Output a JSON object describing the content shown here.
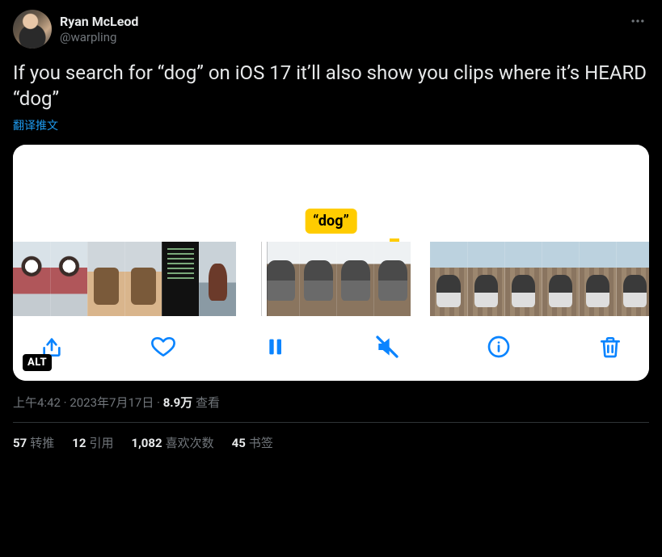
{
  "author": {
    "display_name": "Ryan McLeod",
    "handle": "@warpling"
  },
  "tweet_text": "If you search for “dog” on iOS 17 it’ll also show you clips where it’s HEARD “dog”",
  "translate_label": "翻译推文",
  "media": {
    "caption_label": "“dog”",
    "alt_badge": "ALT",
    "toolbar": {
      "share": "share-icon",
      "like": "heart-icon",
      "pause": "pause-icon",
      "mute": "speaker-off-icon",
      "info": "info-icon",
      "trash": "trash-icon"
    }
  },
  "meta": {
    "time": "上午4:42",
    "separator1": " · ",
    "date": "2023年7月17日",
    "separator2": " · ",
    "views_number": "8.9万",
    "views_label": " 查看"
  },
  "stats": {
    "retweets_num": "57",
    "retweets_label": "转推",
    "quotes_num": "12",
    "quotes_label": "引用",
    "likes_num": "1,082",
    "likes_label": "喜欢次数",
    "bookmarks_num": "45",
    "bookmarks_label": "书签"
  }
}
